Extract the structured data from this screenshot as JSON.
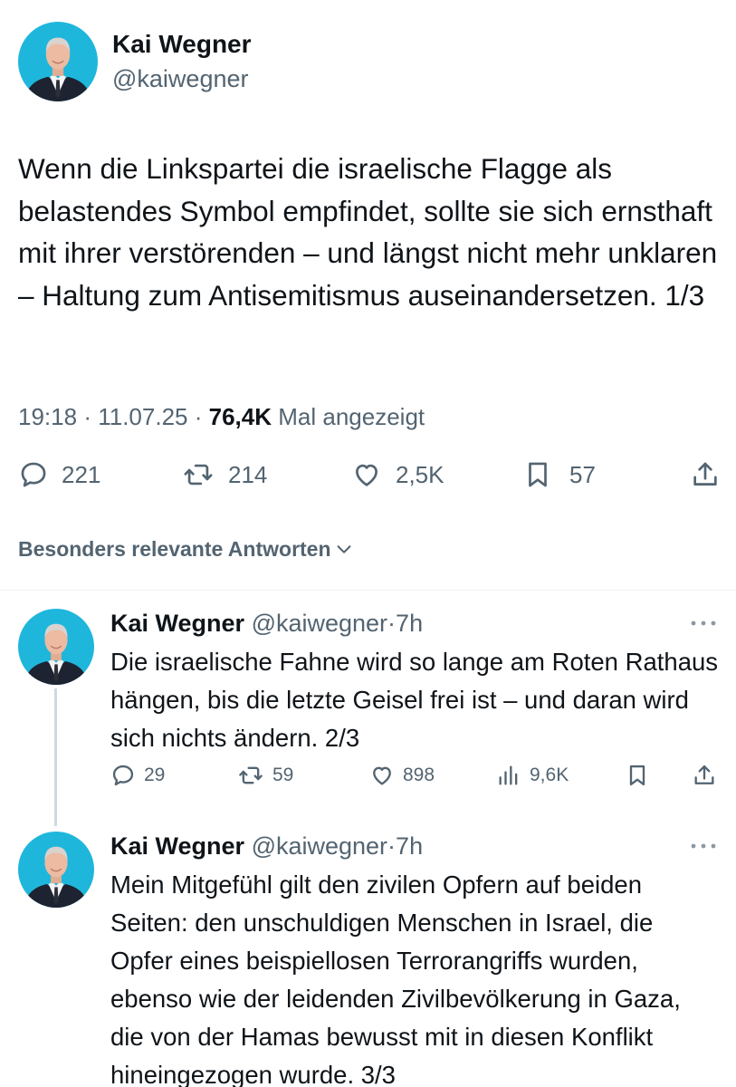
{
  "main_tweet": {
    "author_name": "Kai Wegner",
    "author_handle": "@kaiwegner",
    "text": "Wenn die Linkspartei die israelische Flagge als belastendes Symbol empfindet, sollte sie sich ernsthaft mit ihrer verstörenden – und längst nicht mehr unklaren – Haltung zum Antisemitismus auseinandersetzen. 1/3",
    "time": "19:18",
    "date": "11.07.25",
    "separator": "·",
    "views_count": "76,4K",
    "views_label": "Mal angezeigt",
    "replies": "221",
    "reposts": "214",
    "likes": "2,5K",
    "bookmarks": "57"
  },
  "sort": {
    "label": "Besonders relevante Antworten"
  },
  "thread": [
    {
      "author_name": "Kai Wegner",
      "author_handle": "@kaiwegner",
      "separator": "·",
      "time": "7h",
      "text": "Die israelische Fahne wird so lange am Roten Rathaus hängen, bis die letzte Geisel frei ist – und daran wird sich nichts ändern. 2/3",
      "replies": "29",
      "reposts": "59",
      "likes": "898",
      "views": "9,6K"
    },
    {
      "author_name": "Kai Wegner",
      "author_handle": "@kaiwegner",
      "separator": "·",
      "time": "7h",
      "text": "Mein Mitgefühl gilt den zivilen Opfern auf beiden Seiten: den unschuldigen Menschen in Israel, die Opfer eines beispiellosen Terrorangriffs wurden, ebenso wie der leidenden Zivilbevölkerung in Gaza, die von der Hamas bewusst mit in diesen Konflikt hineingezogen wurde. 3/3"
    }
  ],
  "icons": {
    "reply": "reply-icon",
    "repost": "repost-icon",
    "like": "like-icon",
    "bookmark": "bookmark-icon",
    "share": "share-icon",
    "views": "views-icon",
    "more": "more-icon",
    "chevron": "chevron-down-icon"
  },
  "colors": {
    "text_primary": "#0f1419",
    "text_secondary": "#536471",
    "avatar_background": "#1fb6dc",
    "thread_line": "#cfd9de"
  }
}
